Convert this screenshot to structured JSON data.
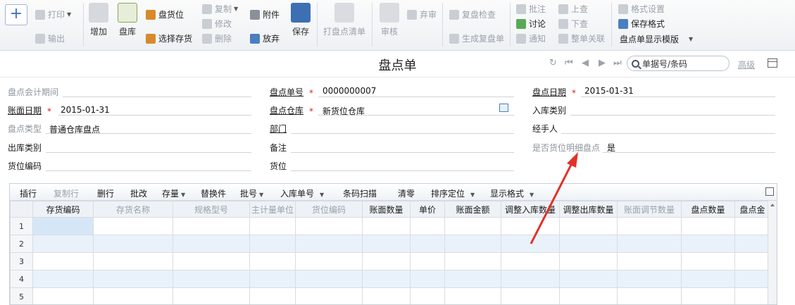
{
  "ribbon": {
    "new_symbol": "+",
    "print": "打印",
    "export": "输出",
    "add": "增加",
    "stocktake": "盘库",
    "stocktake_location": "盘货位",
    "select_inventory": "选择存货",
    "copy": "复制",
    "modify": "修改",
    "delete": "删除",
    "attachment": "附件",
    "abandon": "放弃",
    "save": "保存",
    "print_checklist": "打盘点清单",
    "audit": "审核",
    "discard_audit": "弃审",
    "recheck": "复盘检查",
    "generate_recheck": "生成复盘单",
    "annotate": "批注",
    "discuss": "讨论",
    "notify": "通知",
    "prev_doc": "上查",
    "next_doc": "下查",
    "whole_link": "整单关联",
    "format_settings": "格式设置",
    "save_format": "保存格式",
    "display_template": "盘点单显示模版"
  },
  "titlebar": {
    "title": "盘点单",
    "search_placeholder": "单据号/条码",
    "advanced": "高级"
  },
  "form": {
    "period_label": "盘点会计期间",
    "period_value": "",
    "doc_no_label": "盘点单号",
    "doc_no_value": "0000000007",
    "date_label": "盘点日期",
    "date_value": "2015-01-31",
    "book_date_label": "账面日期",
    "book_date_value": "2015-01-31",
    "warehouse_label": "盘点仓库",
    "warehouse_value": "新货位仓库",
    "in_type_label": "入库类别",
    "in_type_value": "",
    "type_label": "盘点类型",
    "type_value": "普通仓库盘点",
    "dept_label": "部门",
    "dept_value": "",
    "handler_label": "经手人",
    "handler_value": "",
    "out_type_label": "出库类别",
    "out_type_value": "",
    "remark_label": "备注",
    "remark_value": "",
    "detail_label": "是否货位明细盘点",
    "detail_value": "是",
    "loc_code_label": "货位编码",
    "loc_code_value": "",
    "location_label": "货位",
    "location_value": ""
  },
  "grid": {
    "toolbar": {
      "insert": "插行",
      "copy_row": "复制行",
      "delete_row": "删行",
      "batch_edit": "批改",
      "stock": "存量",
      "replace": "替换件",
      "batch_no": "批号",
      "in_doc_no": "入库单号",
      "barcode": "条码扫描",
      "zero": "清零",
      "sort": "排序定位",
      "display_format": "显示格式"
    },
    "columns": [
      "",
      "存货编码",
      "存货名称",
      "规格型号",
      "主计量单位",
      "货位编码",
      "账面数量",
      "单价",
      "账面金额",
      "调整入库数量",
      "调整出库数量",
      "账面调节数量",
      "盘点数量",
      "盘点金"
    ],
    "rows": [
      "1",
      "2",
      "3",
      "4",
      "5"
    ]
  },
  "colors": {
    "accent": "#4a7fc1",
    "required": "#e02020",
    "annotation_arrow": "#e0322a",
    "row_alt": "#e9f2fb"
  }
}
